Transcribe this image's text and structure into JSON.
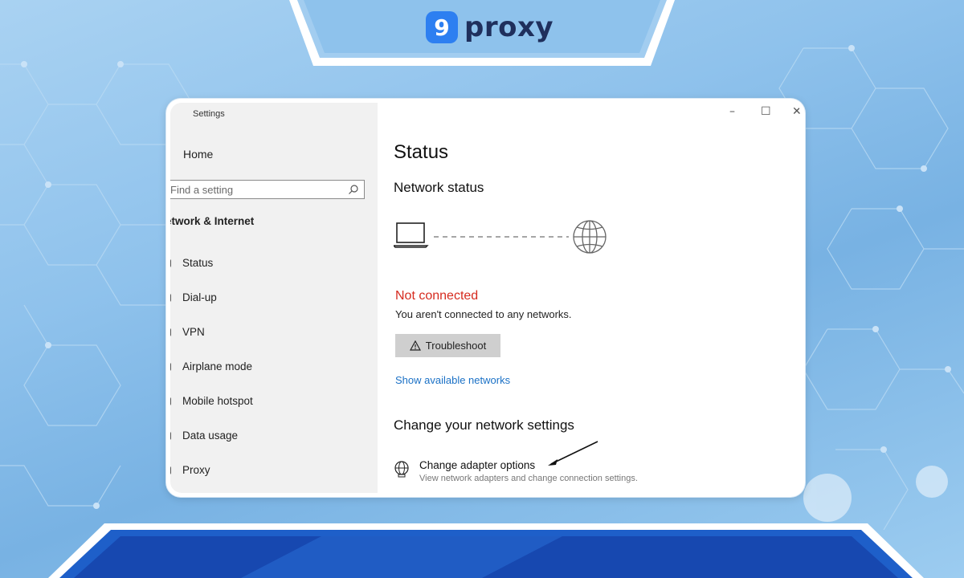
{
  "brand": {
    "logo_glyph": "9",
    "logo_text": "proxy",
    "accent_color": "#2d7ff1",
    "text_color": "#1f2f5c"
  },
  "window": {
    "title": "Settings",
    "controls": {
      "minimize": "–",
      "maximize": "☐",
      "close": "✕"
    }
  },
  "sidebar": {
    "home_label": "Home",
    "search_placeholder": "Find a setting",
    "section_title": "etwork & Internet",
    "items": [
      {
        "label": "Status",
        "icon": "status-icon"
      },
      {
        "label": "Dial-up",
        "icon": "dialup-icon"
      },
      {
        "label": "VPN",
        "icon": "vpn-icon"
      },
      {
        "label": "Airplane mode",
        "icon": "airplane-icon"
      },
      {
        "label": "Mobile hotspot",
        "icon": "hotspot-icon"
      },
      {
        "label": "Data usage",
        "icon": "data-usage-icon"
      },
      {
        "label": "Proxy",
        "icon": "proxy-icon"
      }
    ]
  },
  "main": {
    "heading": "Status",
    "network_status_heading": "Network status",
    "connection_state": "Not connected",
    "connection_state_color": "#d62b1f",
    "connection_desc": "You aren't connected to any networks.",
    "troubleshoot_label": "Troubleshoot",
    "show_networks_link": "Show available networks",
    "change_settings_heading": "Change your network settings",
    "adapter_option": {
      "title": "Change adapter options",
      "desc": "View network adapters and change connection settings."
    }
  }
}
